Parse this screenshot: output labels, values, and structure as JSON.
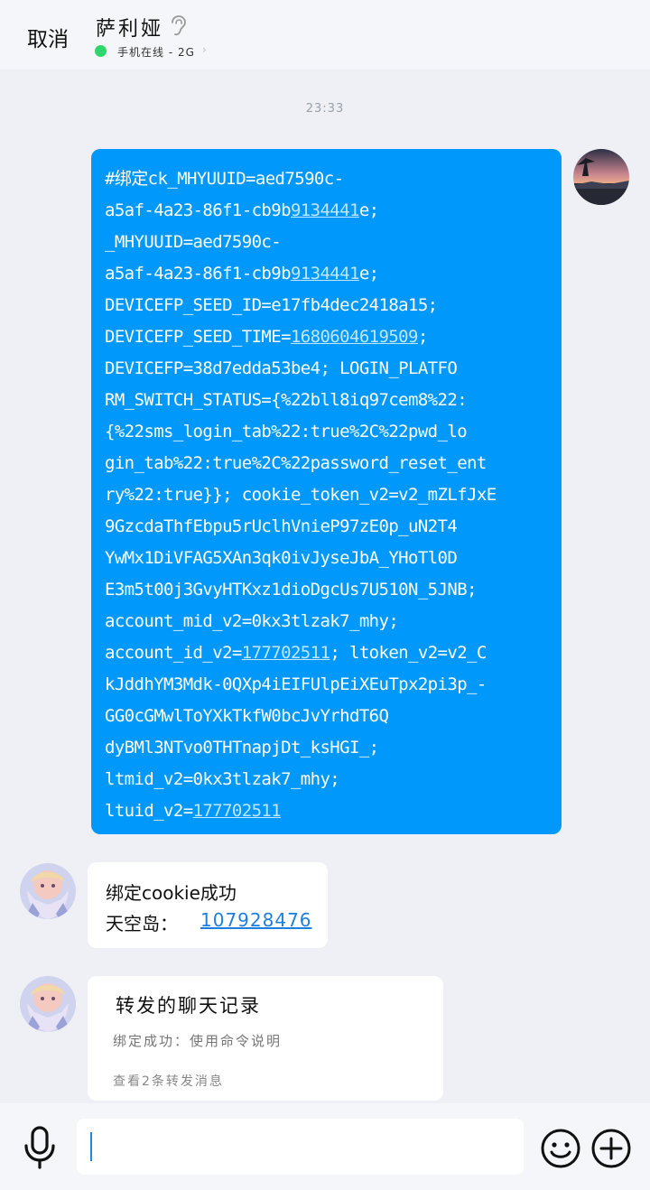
{
  "header": {
    "cancel_label": "取消",
    "contact_name": "萨利娅",
    "status_text": "手机在线 - 2G",
    "status_color": "#2ed66b"
  },
  "chat": {
    "timestamp": "23:33",
    "sent_message": {
      "lines": [
        [
          {
            "t": "#绑定ck_MHYUUID=aed7590c-"
          }
        ],
        [
          {
            "t": "a5af-4a23-86f1-cb9b"
          },
          {
            "t": "9134441",
            "link": true
          },
          {
            "t": "e;"
          }
        ],
        [
          {
            "t": "_MHYUUID=aed7590c-"
          }
        ],
        [
          {
            "t": "a5af-4a23-86f1-cb9b"
          },
          {
            "t": "9134441",
            "link": true
          },
          {
            "t": "e;"
          }
        ],
        [
          {
            "t": "DEVICEFP_SEED_ID=e17fb4dec2418a15;"
          }
        ],
        [
          {
            "t": "DEVICEFP_SEED_TIME="
          },
          {
            "t": "1680604619509",
            "link": true
          },
          {
            "t": ";"
          }
        ],
        [
          {
            "t": "DEVICEFP=38d7edda53be4; LOGIN_PLATFO"
          }
        ],
        [
          {
            "t": "RM_SWITCH_STATUS={%22bll8iq97cem8%22:"
          }
        ],
        [
          {
            "t": "{%22sms_login_tab%22:true%2C%22pwd_lo"
          }
        ],
        [
          {
            "t": "gin_tab%22:true%2C%22password_reset_ent"
          }
        ],
        [
          {
            "t": "ry%22:true}}; cookie_token_v2=v2_mZLfJxE"
          }
        ],
        [
          {
            "t": "9GzcdaThfEbpu5rUclhVnieP97zE0p_uN2T4"
          }
        ],
        [
          {
            "t": "YwMx1DiVFAG5XAn3qk0ivJyseJbA_YHoTl0D"
          }
        ],
        [
          {
            "t": "E3m5t00j3GvyHTKxz1dioDgcUs7U510N_5JNB;"
          }
        ],
        [
          {
            "t": "account_mid_v2=0kx3tlzak7_mhy;"
          }
        ],
        [
          {
            "t": "account_id_v2="
          },
          {
            "t": "177702511",
            "link": true
          },
          {
            "t": "; ltoken_v2=v2_C"
          }
        ],
        [
          {
            "t": "kJddhYM3Mdk-0QXp4iEIFUlpEiXEuTpx2pi3p_-"
          }
        ],
        [
          {
            "t": "GG0cGMwlToYXkTkfW0bcJvYrhdT6Q"
          }
        ],
        [
          {
            "t": "dyBMl3NTvo0THTnapjDt_ksHGI_;"
          }
        ],
        [
          {
            "t": "ltmid_v2=0kx3tlzak7_mhy;"
          }
        ],
        [
          {
            "t": "ltuid_v2="
          },
          {
            "t": "177702511",
            "link": true
          }
        ]
      ]
    },
    "bind_reply": {
      "line1": "绑定cookie成功",
      "uid_label": "天空岛：",
      "uid_value": "107928476"
    },
    "forward_card": {
      "title": "转发的聊天记录",
      "preview": "绑定成功：使用命令说明",
      "footer": "查看2条转发消息"
    }
  },
  "input": {
    "value": "",
    "placeholder": ""
  },
  "colors": {
    "sent_bubble": "#0098fa",
    "link_on_blue": "#bfe6ff",
    "link": "#1f7fe0"
  }
}
